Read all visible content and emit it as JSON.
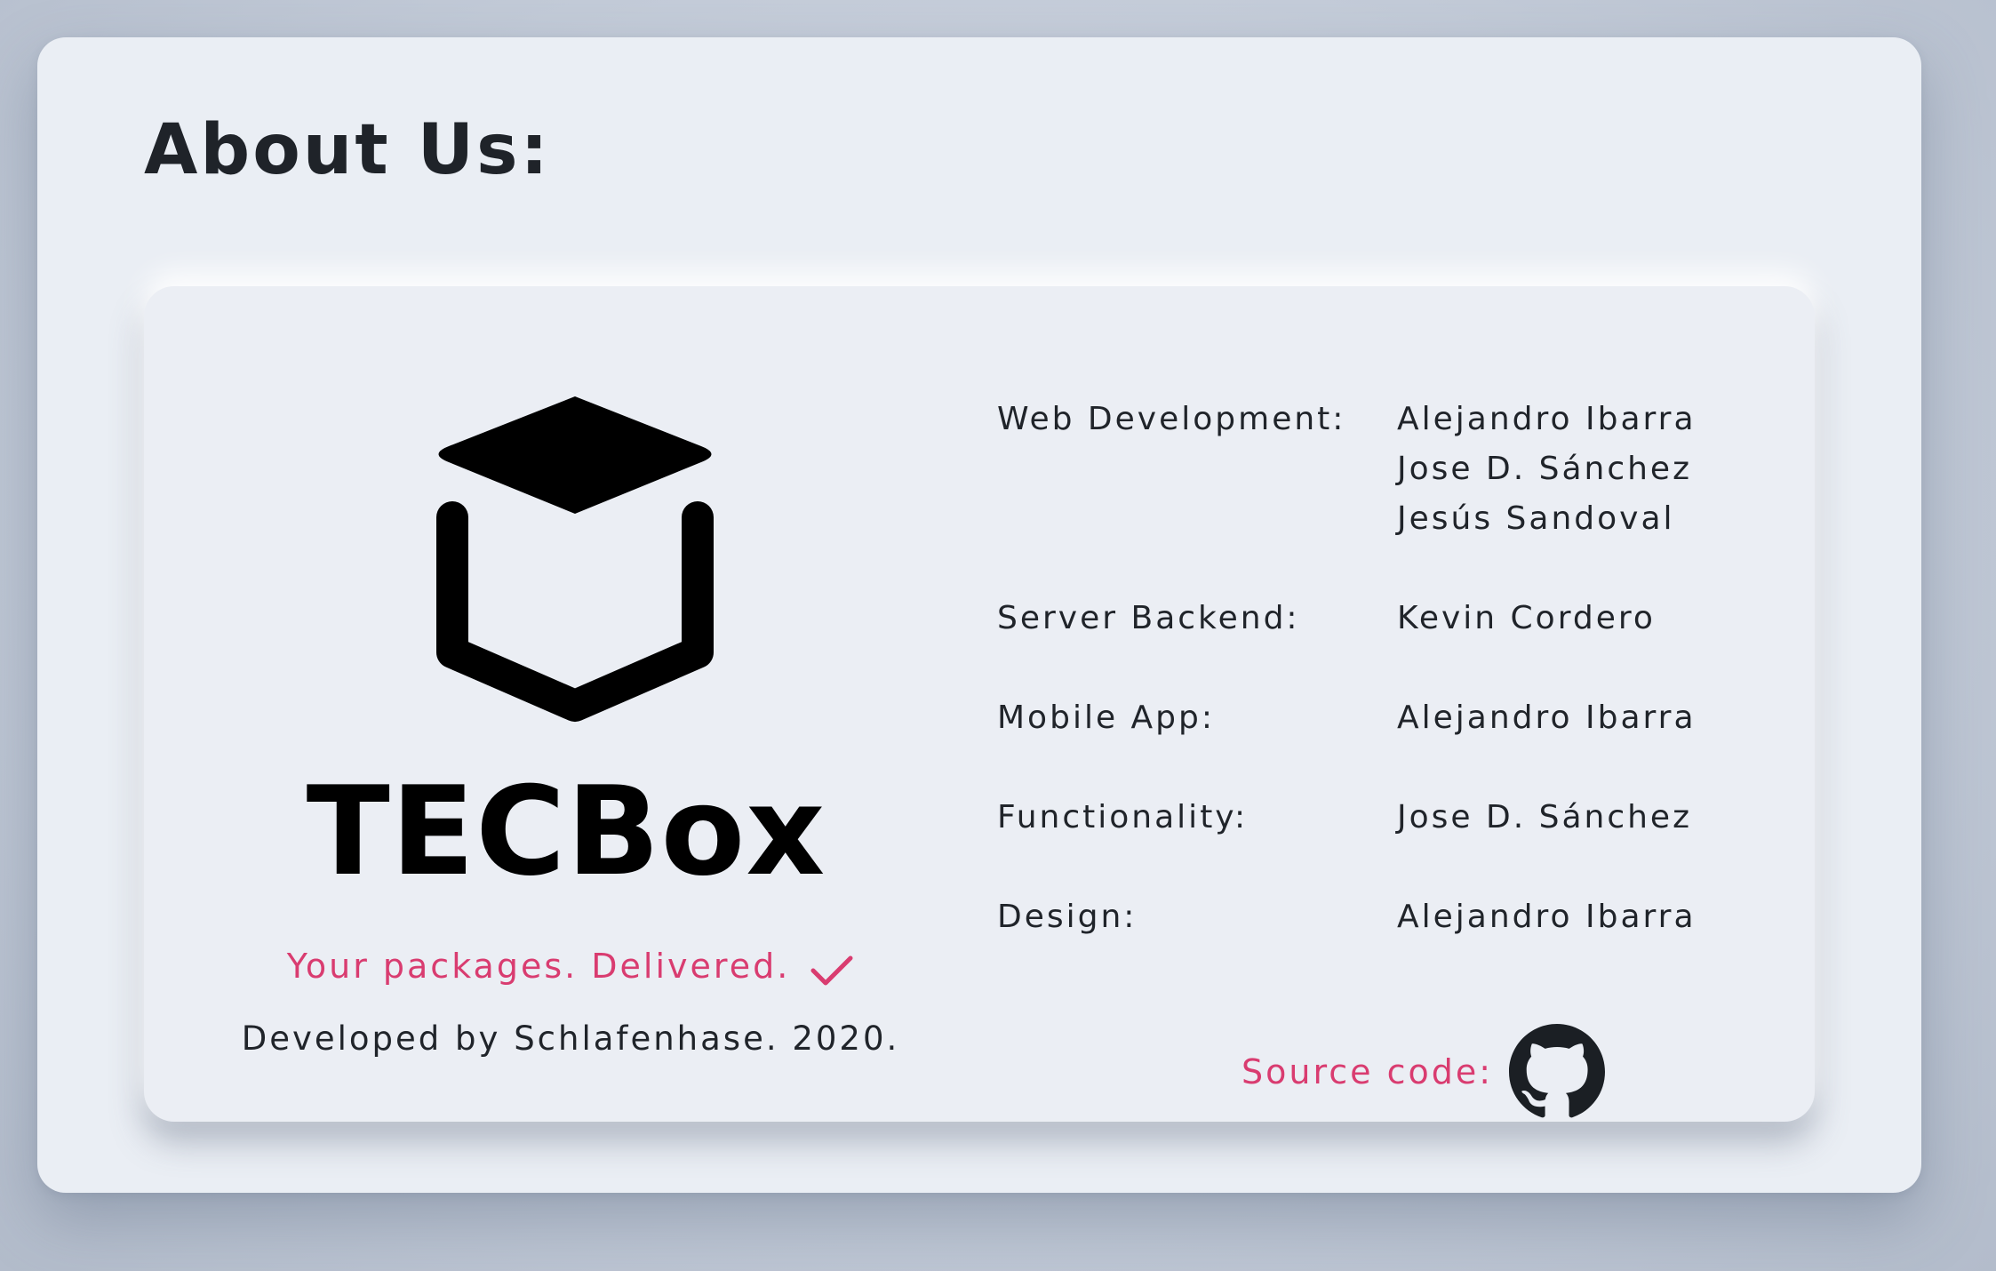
{
  "page": {
    "title": "About Us:"
  },
  "brand": {
    "logo_icon": "package-box-icon",
    "name": "TECBox",
    "tagline": "Your packages. Delivered.",
    "tagline_icon": "checkmark-icon",
    "credit": "Developed by Schlafenhase. 2020."
  },
  "team": [
    {
      "role": "Web Development:",
      "names": [
        "Alejandro Ibarra",
        "Jose D. Sánchez",
        "Jesús Sandoval"
      ]
    },
    {
      "role": "Server Backend:",
      "names": [
        "Kevin Cordero"
      ]
    },
    {
      "role": "Mobile App:",
      "names": [
        "Alejandro Ibarra"
      ]
    },
    {
      "role": "Functionality:",
      "names": [
        "Jose D. Sánchez"
      ]
    },
    {
      "role": "Design:",
      "names": [
        "Alejandro Ibarra"
      ]
    }
  ],
  "source": {
    "label": "Source code:",
    "icon": "github-icon"
  },
  "colors": {
    "accent": "#d93c70",
    "text": "#20242a",
    "card_background": "#ebeef4"
  }
}
